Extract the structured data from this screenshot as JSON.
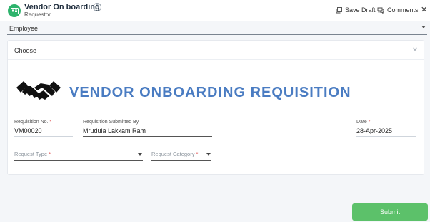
{
  "header": {
    "title": "Vendor On boarding",
    "subtitle": "Requestor",
    "help_icon": "?",
    "save_draft_label": "Save Draft",
    "comments_label": "Comments",
    "close_label": "✕"
  },
  "employee_select": {
    "value": "Employee"
  },
  "choose_select": {
    "value": "Choose"
  },
  "form": {
    "heading": "VENDOR ONBOARDING REQUISITION",
    "requisition_no": {
      "label": "Requisition No.",
      "required": "*",
      "value": "VM00020"
    },
    "submitted_by": {
      "label": "Requisition Submitted By",
      "value": "Mrudula Lakkam Ram"
    },
    "date": {
      "label": "Date",
      "required": "*",
      "value": "28-Apr-2025"
    },
    "request_type": {
      "label": "Request Type",
      "required": "*"
    },
    "request_category": {
      "label": "Request Category",
      "required": "*"
    }
  },
  "footer": {
    "submit_label": "Submit"
  },
  "colors": {
    "accent_green": "#5cc16a",
    "app_icon": "#2db36c",
    "title_blue": "#4a7cc2"
  }
}
